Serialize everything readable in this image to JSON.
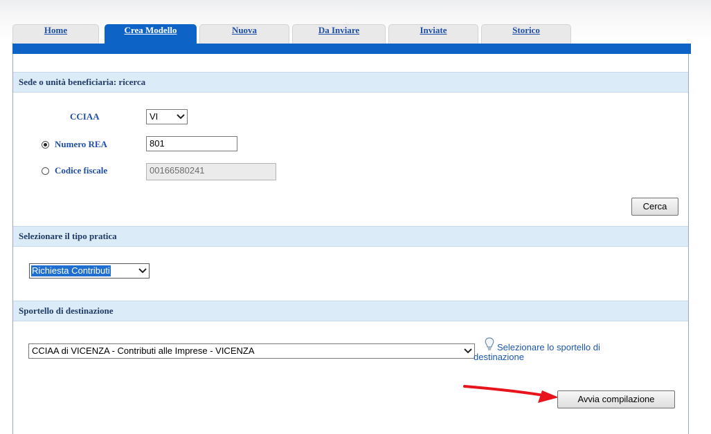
{
  "tabs": [
    {
      "label": "Home",
      "active": false
    },
    {
      "label": "Crea Modello",
      "active": true
    },
    {
      "label": "Nuova",
      "active": false
    },
    {
      "label": "Da Inviare",
      "active": false
    },
    {
      "label": "Inviate",
      "active": false
    },
    {
      "label": "Storico",
      "active": false
    }
  ],
  "colors": {
    "accent": "#0e63c7",
    "section_bg": "#dcebf8",
    "label": "#1f4ea6"
  },
  "search": {
    "header": "Sede o unità beneficiaria: ricerca",
    "cciaa_label": "CCIAA",
    "cciaa_value": "VI",
    "rea_label": "Numero REA",
    "rea_value": "801",
    "rea_selected": true,
    "cf_label": "Codice fiscale",
    "cf_value": "00166580241",
    "cf_selected": false,
    "search_button": "Cerca"
  },
  "practice": {
    "header": "Selezionare il tipo pratica",
    "type_value": "Richiesta Contributi"
  },
  "destination": {
    "header": "Sportello di destinazione",
    "value": "CCIAA di VICENZA - Contributi alle Imprese - VICENZA",
    "hint_line1": "Selezionare lo sportello di",
    "hint_line2": "destinazione",
    "hint_icon": "lightbulb-icon",
    "start_button": "Avvia compilazione"
  },
  "annotation": {
    "arrow_color": "#e8141b"
  }
}
